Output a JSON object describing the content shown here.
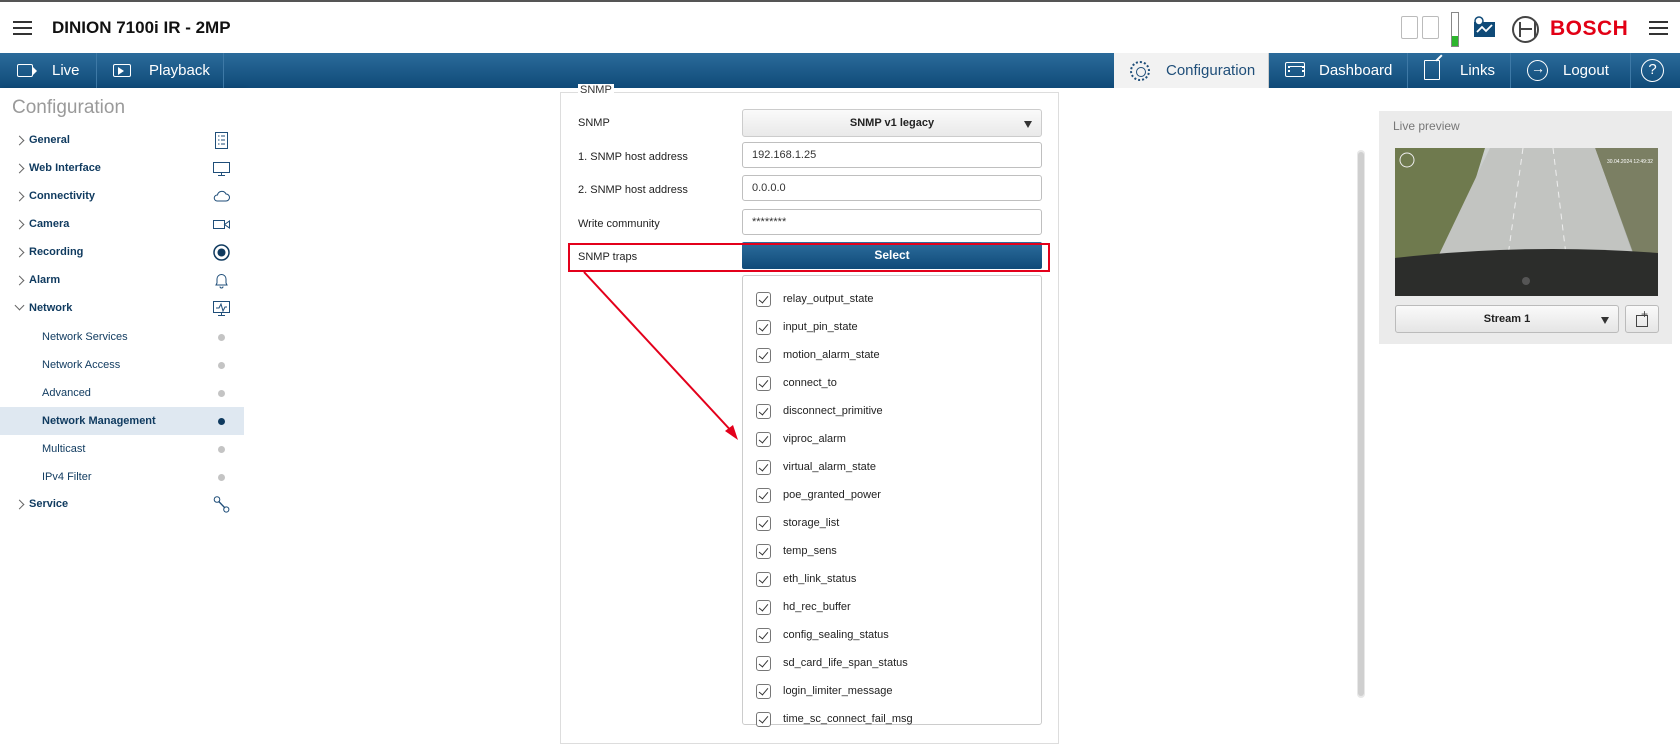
{
  "header": {
    "device_title": "DINION 7100i IR - 2MP",
    "brand": "BOSCH",
    "brand_color": "#e20015"
  },
  "nav": {
    "live": "Live",
    "playback": "Playback",
    "configuration": "Configuration",
    "dashboard": "Dashboard",
    "links": "Links",
    "logout": "Logout",
    "help": "?",
    "bar_color": "#0f4a78"
  },
  "sidebar": {
    "title": "Configuration",
    "items": [
      {
        "label": "General",
        "icon": "document-list-icon"
      },
      {
        "label": "Web Interface",
        "icon": "monitor-icon"
      },
      {
        "label": "Connectivity",
        "icon": "cloud-icon"
      },
      {
        "label": "Camera",
        "icon": "camera-icon"
      },
      {
        "label": "Recording",
        "icon": "record-icon"
      },
      {
        "label": "Alarm",
        "icon": "bell-icon"
      },
      {
        "label": "Network",
        "icon": "network-monitor-icon"
      },
      {
        "label": "Service",
        "icon": "wrench-icon"
      }
    ],
    "network_subitems": [
      {
        "label": "Network Services"
      },
      {
        "label": "Network Access"
      },
      {
        "label": "Advanced"
      },
      {
        "label": "Network Management"
      },
      {
        "label": "Multicast"
      },
      {
        "label": "IPv4 Filter"
      }
    ],
    "selected": "Network Management"
  },
  "snmp": {
    "section_title": "SNMP",
    "snmp_label": "SNMP",
    "snmp_value": "SNMP v1 legacy",
    "host1_label": "1. SNMP host address",
    "host1_value": "192.168.1.25",
    "host2_label": "2. SNMP host address",
    "host2_value": "0.0.0.0",
    "write_community_label": "Write community",
    "write_community_value": "********",
    "traps_label": "SNMP traps",
    "traps_button": "Select",
    "traps": [
      "relay_output_state",
      "input_pin_state",
      "motion_alarm_state",
      "connect_to",
      "disconnect_primitive",
      "viproc_alarm",
      "virtual_alarm_state",
      "poe_granted_power",
      "storage_list",
      "temp_sens",
      "eth_link_status",
      "hd_rec_buffer",
      "config_sealing_status",
      "sd_card_life_span_status",
      "login_limiter_message",
      "time_sc_connect_fail_msg"
    ],
    "annotation_color": "#e3001b"
  },
  "preview": {
    "title": "Live preview",
    "stream": "Stream 1",
    "overlay_timestamp": "30.04.2024 12:49:32"
  }
}
